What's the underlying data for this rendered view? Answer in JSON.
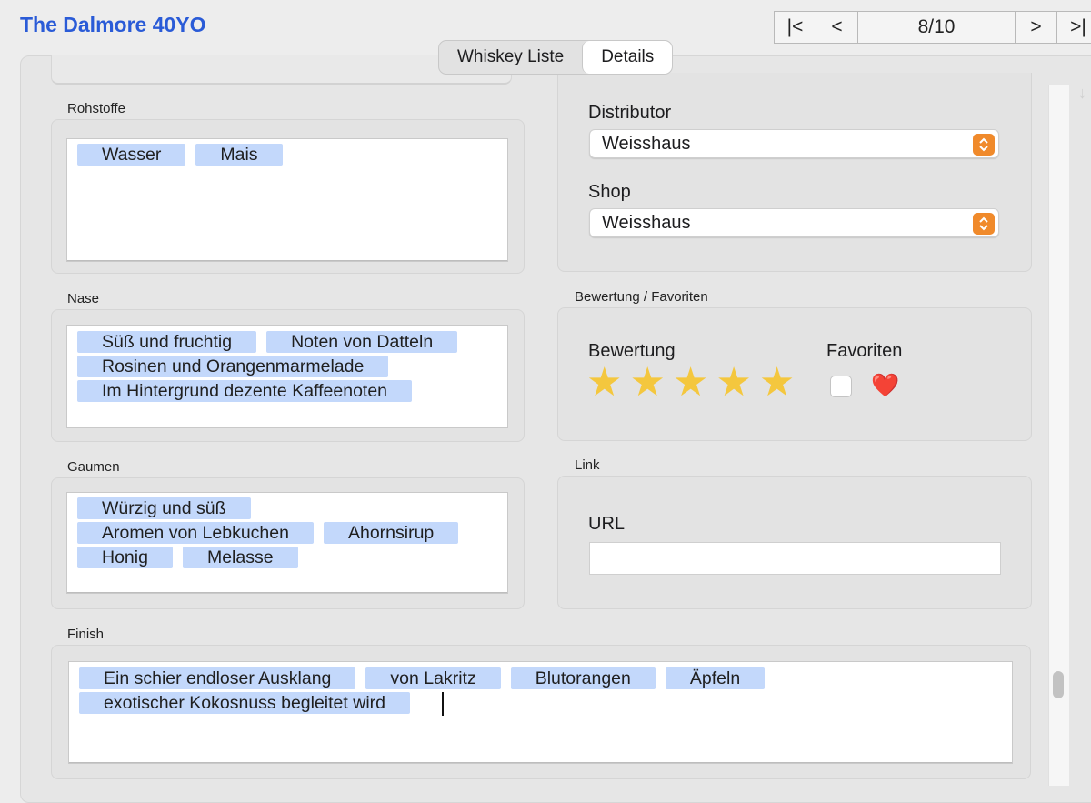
{
  "window": {
    "title": "The Dalmore 40YO"
  },
  "navigator": {
    "first": "|<",
    "prev": "<",
    "position": "8/10",
    "next": ">",
    "last": ">|"
  },
  "tabs": [
    {
      "label": "Whiskey Liste",
      "active": false
    },
    {
      "label": "Details",
      "active": true
    }
  ],
  "rohstoffe": {
    "label": "Rohstoffe",
    "lines": [
      [
        "Wasser",
        "Mais"
      ]
    ]
  },
  "nase": {
    "label": "Nase",
    "lines": [
      [
        "Süß und fruchtig",
        "Noten von Datteln"
      ],
      [
        "Rosinen und Orangenmarmelade"
      ],
      [
        "Im Hintergrund dezente Kaffeenoten"
      ]
    ]
  },
  "gaumen": {
    "label": "Gaumen",
    "lines": [
      [
        "Würzig und süß"
      ],
      [
        "Aromen von Lebkuchen",
        "Ahornsirup"
      ],
      [
        "Honig",
        "Melasse"
      ]
    ]
  },
  "finish": {
    "label": "Finish",
    "lines": [
      [
        "Ein schier endloser Ausklang",
        "von Lakritz",
        "Blutorangen",
        "Äpfeln"
      ],
      [
        "exotischer Kokosnuss begleitet wird"
      ]
    ]
  },
  "distributor": {
    "label": "Distributor",
    "value": "Weisshaus"
  },
  "shop": {
    "label": "Shop",
    "value": "Weisshaus"
  },
  "rating": {
    "section_label": "Bewertung / Favoriten",
    "rating_label": "Bewertung",
    "stars": 5,
    "favorites_label": "Favoriten",
    "favorite_checked": false,
    "heart_icon": "❤️"
  },
  "link": {
    "section_label": "Link",
    "url_label": "URL",
    "url_value": ""
  },
  "colors": {
    "title": "#2a5bd7",
    "tag": "#c3d8fb",
    "star": "#f4c73e",
    "stepper": "#f08a2b"
  }
}
